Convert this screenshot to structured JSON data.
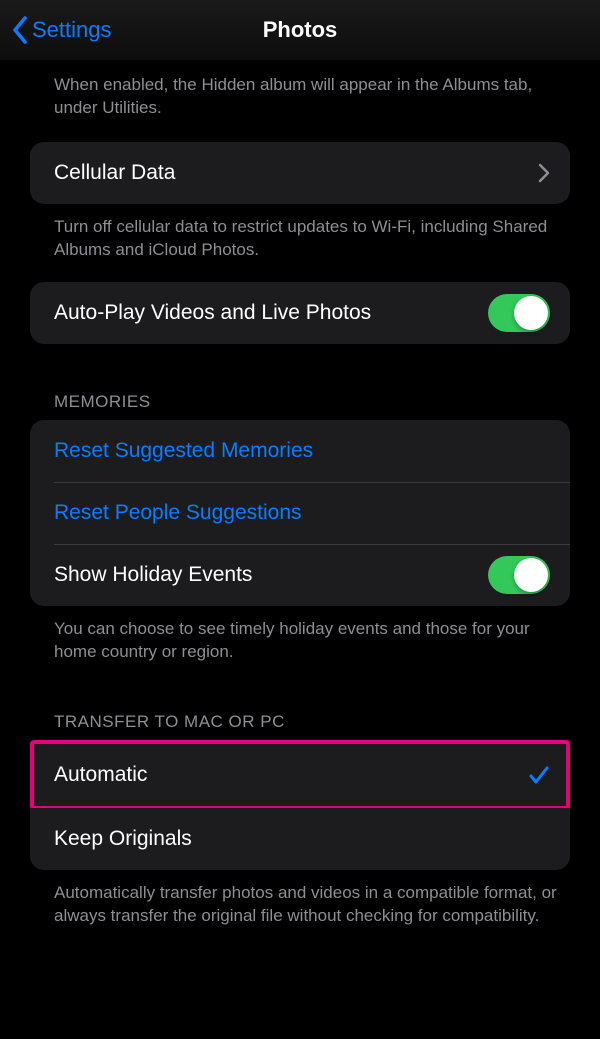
{
  "header": {
    "back": "Settings",
    "title": "Photos"
  },
  "hidden_album_footer": "When enabled, the Hidden album will appear in the Albums tab, under Utilities.",
  "cellular": {
    "label": "Cellular Data",
    "footer": "Turn off cellular data to restrict updates to Wi-Fi, including Shared Albums and iCloud Photos."
  },
  "autoplay": {
    "label": "Auto-Play Videos and Live Photos"
  },
  "memories": {
    "header": "MEMORIES",
    "reset_suggested": "Reset Suggested Memories",
    "reset_people": "Reset People Suggestions",
    "show_holiday": "Show Holiday Events",
    "footer": "You can choose to see timely holiday events and those for your home country or region."
  },
  "transfer": {
    "header": "TRANSFER TO MAC OR PC",
    "automatic": "Automatic",
    "keep_originals": "Keep Originals",
    "footer": "Automatically transfer photos and videos in a compatible format, or always transfer the original file without checking for compatibility."
  }
}
